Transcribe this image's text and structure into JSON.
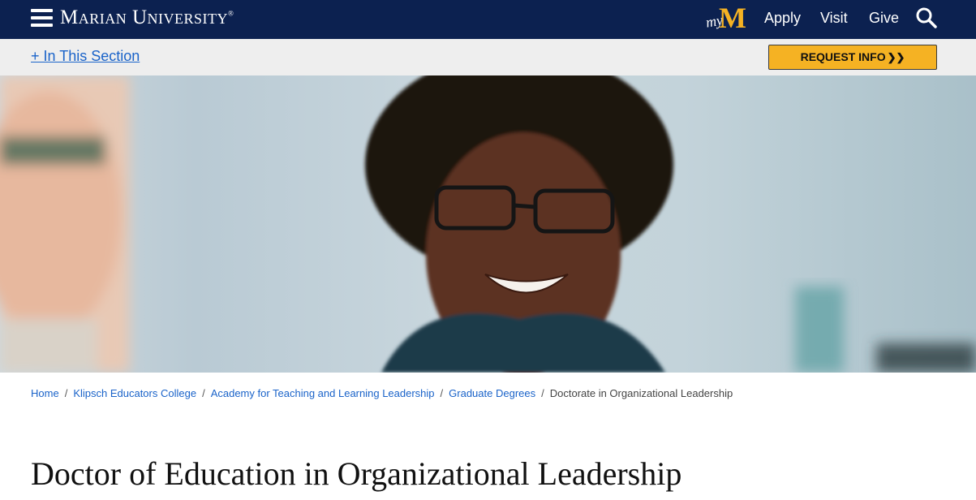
{
  "header": {
    "logo_text": "Marian University",
    "logo_mark": "®",
    "my_m": {
      "my": "my",
      "m": "M"
    },
    "nav": {
      "apply": "Apply",
      "visit": "Visit",
      "give": "Give"
    },
    "menu_icon": "hamburger-icon",
    "search_icon": "search-icon"
  },
  "section_bar": {
    "toggle_label": "+ In This Section",
    "request_label": "REQUEST INFO",
    "request_icon": "double-chevron-right-icon"
  },
  "hero": {
    "image": "student-smiling-photo"
  },
  "breadcrumb": {
    "items": [
      "Home",
      "Klipsch Educators College",
      "Academy for Teaching and Learning Leadership",
      "Graduate Degrees"
    ],
    "current": "Doctorate in Organizational Leadership",
    "separator": "/"
  },
  "page": {
    "title": "Doctor of Education in Organizational Leadership"
  },
  "colors": {
    "navy": "#0c2150",
    "gold": "#f5b223",
    "link": "#1a63c9"
  }
}
